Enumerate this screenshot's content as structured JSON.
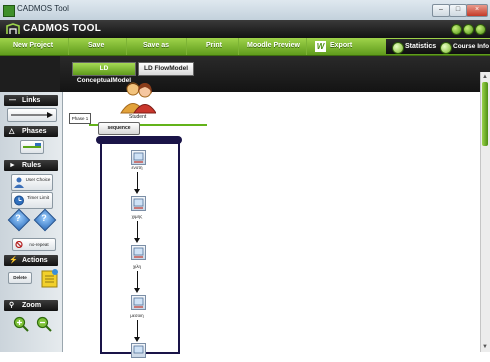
{
  "window": {
    "title": "CADMOS Tool"
  },
  "header": {
    "brand": "CADMOS TOOL"
  },
  "menu": {
    "new_project": "New Project",
    "save": "Save",
    "save_as": "Save as",
    "print": "Print",
    "moodle_preview": "Moodle Preview",
    "export": "Export",
    "statistics": "Statistics",
    "course_info": "Course Info"
  },
  "tabs": {
    "conceptual": "LD ConceptualModel",
    "flow": "LD FlowModel"
  },
  "sidebar": {
    "links": "Links",
    "phases": "Phases",
    "rules": "Rules",
    "user_choice": "User Choice",
    "timer_limit": "Timer Limit",
    "no_repeat": "no-repeat",
    "actions": "Actions",
    "delete": "Delete",
    "zoom": "Zoom"
  },
  "canvas": {
    "role_label": "Student",
    "phase_label": "Phase 1",
    "sequence_label": "sequence",
    "activities": [
      "ενοτη",
      "χιμης",
      "χιλη",
      "μεσοιη"
    ]
  }
}
